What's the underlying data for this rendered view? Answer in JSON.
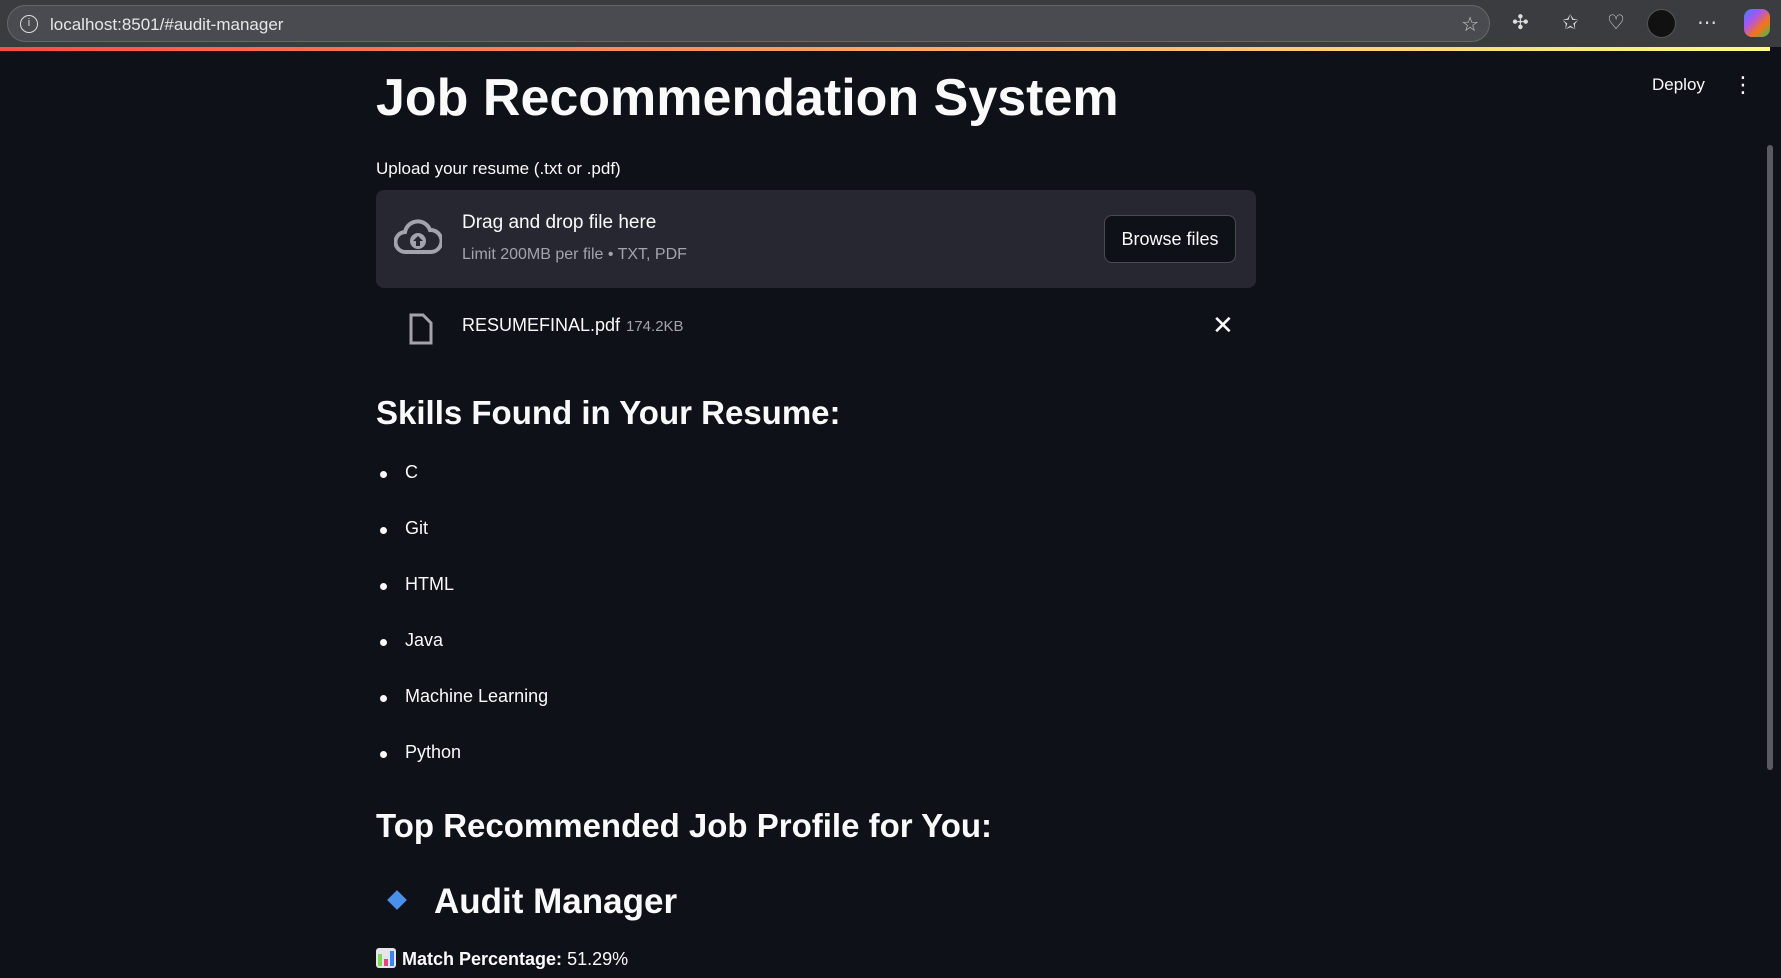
{
  "browser": {
    "url": "localhost:8501/#audit-manager"
  },
  "header": {
    "deploy": "Deploy"
  },
  "main": {
    "title": "Job Recommendation System",
    "uploader": {
      "label": "Upload your resume (.txt or .pdf)",
      "drop_text": "Drag and drop file here",
      "limit_text": "Limit 200MB per file • TXT, PDF",
      "browse": "Browse files"
    },
    "file": {
      "name": "RESUMEFINAL.pdf",
      "size": "174.2KB"
    },
    "skills_heading": "Skills Found in Your Resume:",
    "skills": [
      "C",
      "Git",
      "HTML",
      "Java",
      "Machine Learning",
      "Python"
    ],
    "jobs_heading": "Top Recommended Job Profile for You:",
    "job": {
      "title": "Audit Manager",
      "match_label": "Match Percentage:",
      "match_value": "51.29%"
    }
  }
}
